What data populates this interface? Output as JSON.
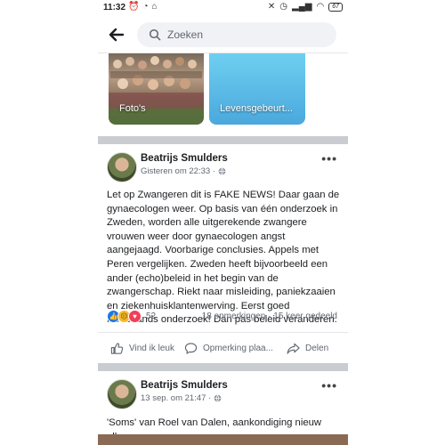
{
  "status_bar": {
    "time": "11:32",
    "battery": "67"
  },
  "search": {
    "placeholder": "Zoeken"
  },
  "tiles": {
    "photos_label": "Foto's",
    "life_events_label": "Levensgebeurt..."
  },
  "posts": [
    {
      "author": "Beatrijs Smulders",
      "timestamp": "Gisteren om 22:33 ·",
      "text": "Let op Zwangeren dit is FAKE NEWS! Daar gaan de gynaecologen weer. Op basis van één onderzoek in Zweden, worden alle uitgerekende zwangere vrouwen weer door gynaecologen angst aangejaagd. Voorbarige conclusies. Appels met Peren vergelijken. Zweden heeft bijvoorbeeld een ander (echo)beleid in het begin van de zwangerschap. Riekt naar misleiding, paniekzaaien en ziekenhuisklantenwerving. Eerst goed Nederlands onderzoek! Dan pas beleid veranderen.",
      "reaction_count": "52",
      "comments": "18 opmerkingen",
      "shares": "15 keer gedeeld"
    },
    {
      "author": "Beatrijs Smulders",
      "timestamp": "13 sep. om 21:47 ·",
      "text": "'Soms' van Roel van Dalen, aankondiging nieuw album."
    }
  ],
  "actions": {
    "like": "Vind ik leuk",
    "comment": "Opmerking plaa...",
    "share": "Delen"
  },
  "colors": {
    "accent": "#1877f2",
    "separator": "#c9ccd1",
    "secondary_text": "#606770"
  }
}
